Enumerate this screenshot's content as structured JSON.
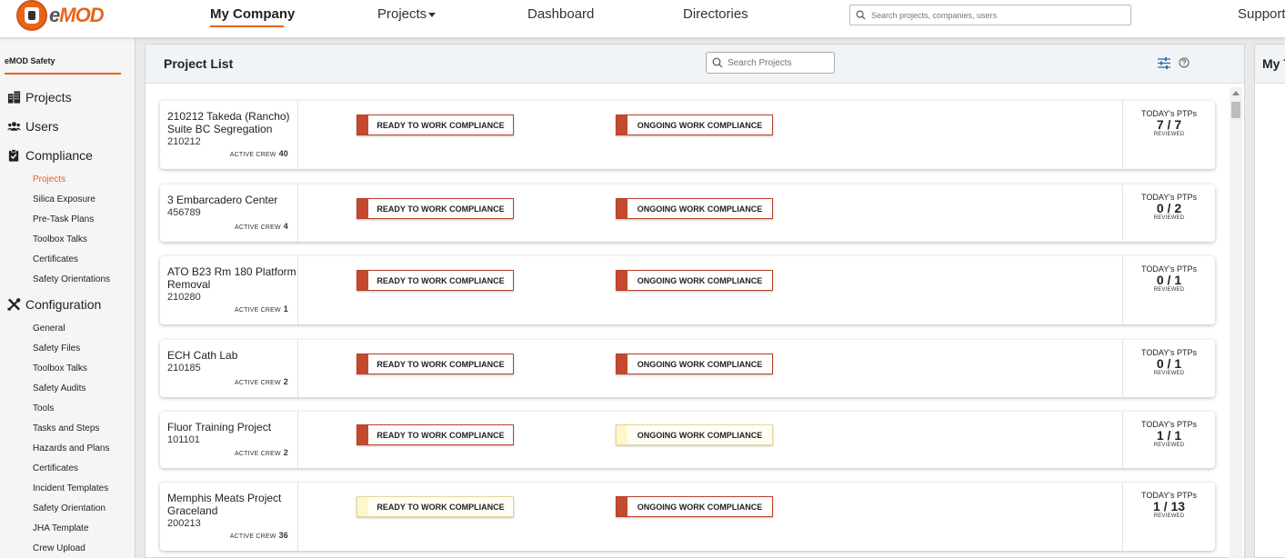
{
  "app": {
    "logo_prefix": "e",
    "logo_name": "MOD"
  },
  "nav": {
    "my_company": "My Company",
    "projects": "Projects",
    "dashboard": "Dashboard",
    "directories": "Directories",
    "support": "Support",
    "search_placeholder": "Search projects, companies, users"
  },
  "sidebar": {
    "title": "eMOD Safety",
    "projects": "Projects",
    "users": "Users",
    "compliance": "Compliance",
    "compliance_items": [
      "Projects",
      "Silica Exposure",
      "Pre-Task Plans",
      "Toolbox Talks",
      "Certificates",
      "Safety Orientations"
    ],
    "configuration": "Configuration",
    "configuration_items": [
      "General",
      "Safety Files",
      "Toolbox Talks",
      "Safety Audits",
      "Tools",
      "Tasks and Steps",
      "Hazards and Plans",
      "Certificates",
      "Incident Templates",
      "Safety Orientation",
      "JHA Template",
      "Crew Upload"
    ]
  },
  "panel": {
    "title": "Project List",
    "search_placeholder": "Search Projects",
    "right_title": "My T"
  },
  "labels": {
    "active_crew": "ACTIVE CREW",
    "ready": "READY TO WORK COMPLIANCE",
    "ongoing": "ONGOING WORK COMPLIANCE",
    "todays_ptps": "TODAY's PTPs",
    "reviewed": "REVIEWED"
  },
  "projects": [
    {
      "name": "210212 Takeda (Rancho) Suite BC Segregation",
      "number": "210212",
      "crew": "40",
      "ptp": "7 / 7",
      "ready_status": "noncompliant",
      "ongoing_status": "noncompliant"
    },
    {
      "name": "3 Embarcadero Center",
      "number": "456789",
      "crew": "4",
      "ptp": "0 / 2",
      "ready_status": "noncompliant",
      "ongoing_status": "noncompliant"
    },
    {
      "name": "ATO B23 Rm 180 Platform Removal",
      "number": "210280",
      "crew": "1",
      "ptp": "0 / 1",
      "ready_status": "noncompliant",
      "ongoing_status": "noncompliant"
    },
    {
      "name": "ECH Cath Lab",
      "number": "210185",
      "crew": "2",
      "ptp": "0 / 1",
      "ready_status": "noncompliant",
      "ongoing_status": "noncompliant"
    },
    {
      "name": "Fluor Training Project",
      "number": "101101",
      "crew": "2",
      "ptp": "1 / 1",
      "ready_status": "noncompliant",
      "ongoing_status": "pending"
    },
    {
      "name": "Memphis Meats Project Graceland",
      "number": "200213",
      "crew": "36",
      "ptp": "1 / 13",
      "ready_status": "pending",
      "ongoing_status": "noncompliant"
    }
  ]
}
